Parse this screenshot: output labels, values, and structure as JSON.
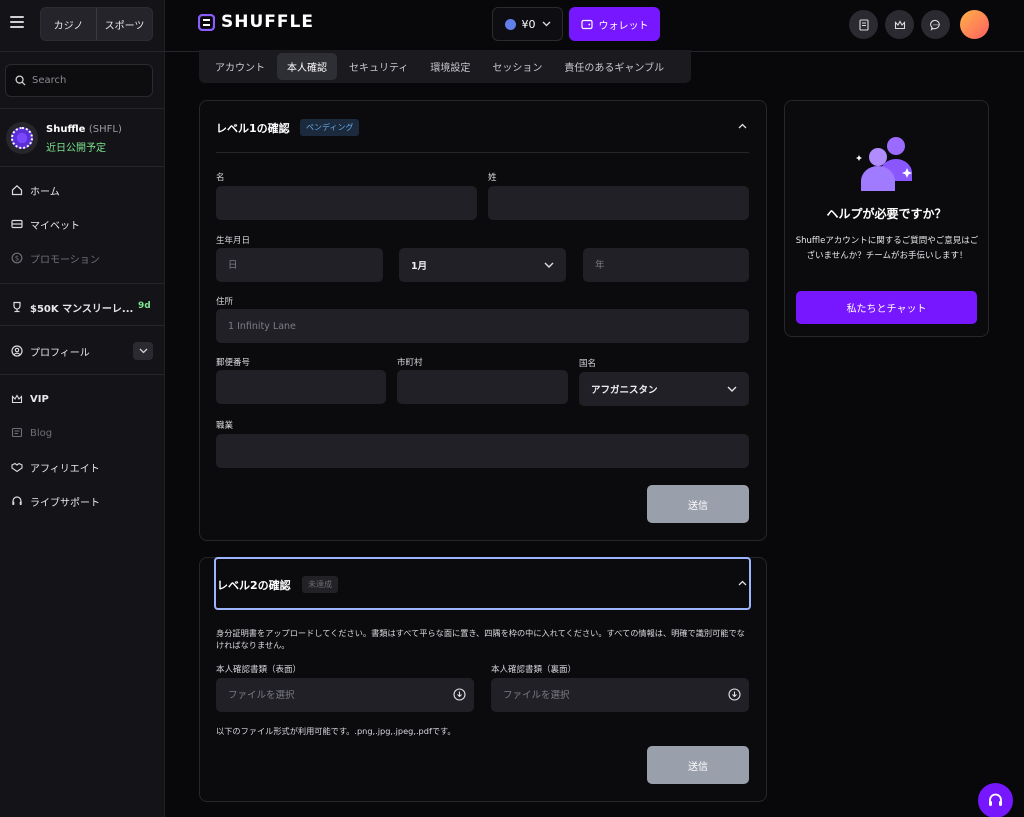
{
  "sidebar": {
    "toggle": {
      "casino": "カジノ",
      "sports": "スポーツ"
    },
    "search_placeholder": "Search",
    "token": {
      "name": "Shuffle",
      "ticker": "(SHFL)",
      "status": "近日公開予定"
    },
    "nav": {
      "home": "ホーム",
      "mybets": "マイベット",
      "promotions": "プロモーション",
      "race": "$50K マンスリーレ...",
      "race_badge": "9d",
      "profile": "プロフィール",
      "vip": "VIP",
      "blog": "Blog",
      "affiliate": "アフィリエイト",
      "live_support": "ライブサポート"
    }
  },
  "header": {
    "logo": "SHUFFLE",
    "balance": "¥0",
    "wallet": "ウォレット"
  },
  "tabs": [
    "アカウント",
    "本人確認",
    "セキュリティ",
    "環境設定",
    "セッション",
    "責任のあるギャンブル"
  ],
  "level1": {
    "title": "レベル1の確認",
    "status": "ペンディング",
    "labels": {
      "first_name": "名",
      "last_name": "姓",
      "dob": "生年月日",
      "address": "住所",
      "postal": "郵便番号",
      "city": "市町村",
      "country": "国名",
      "occupation": "職業"
    },
    "placeholders": {
      "day": "日",
      "year": "年",
      "address": "1 Infinity Lane"
    },
    "month": "1月",
    "country_value": "アフガニスタン",
    "submit": "送信"
  },
  "level2": {
    "title": "レベル2の確認",
    "status": "未達成",
    "instructions": "身分証明書をアップロードしてください。書類はすべて平らな面に置き、四隅を枠の中に入れてください。すべての情報は、明確で識別可能でなければなりません。",
    "front_label": "本人確認書類（表面）",
    "back_label": "本人確認書類（裏面）",
    "file_placeholder": "ファイルを選択",
    "formats": "以下のファイル形式が利用可能です。.png,.jpg,.jpeg,.pdfです。",
    "submit": "送信"
  },
  "help": {
    "title": "ヘルプが必要ですか？",
    "body": "Shuffleアカウントに関するご質問やご意見はございませんか？チームがお手伝いします！",
    "button": "私たちとチャット"
  },
  "colors": {
    "accent": "#7717ff",
    "success": "#7be38e",
    "pending": "#6aa8e8"
  }
}
